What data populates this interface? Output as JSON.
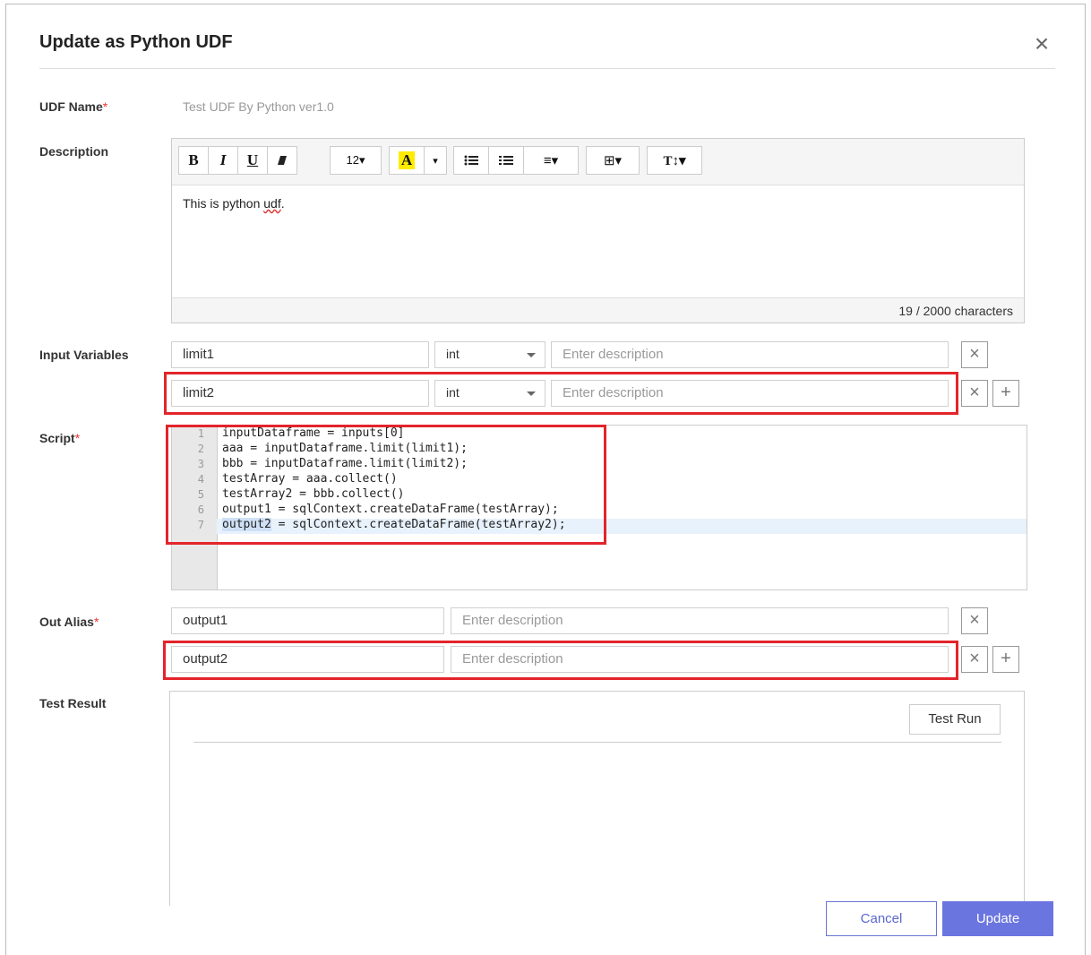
{
  "dialog": {
    "title": "Update as Python UDF",
    "close_glyph": "×"
  },
  "labels": {
    "udf_name": "UDF Name",
    "description": "Description",
    "input_variables": "Input Variables",
    "script": "Script",
    "out_alias": "Out Alias",
    "test_result": "Test Result",
    "required_mark": "*"
  },
  "udf_name": {
    "value": "Test UDF By Python ver1.0"
  },
  "description": {
    "toolbar": {
      "bold": "B",
      "italic": "I",
      "underline": "U",
      "eraser_icon": "eraser-icon",
      "font_size": "12▾",
      "font_color": "A",
      "font_color_caret": "▾",
      "bullet_list_icon": "bullet-list-icon",
      "numbered_list_icon": "numbered-list-icon",
      "align": "≡▾",
      "table": "⊞▾",
      "line_height": "T↕▾"
    },
    "text_before": "This is python ",
    "text_misspelled": "udf",
    "text_after": ".",
    "counter": "19 / 2000 characters"
  },
  "input_variables": [
    {
      "name": "limit1",
      "type": "int",
      "description_placeholder": "Enter description"
    },
    {
      "name": "limit2",
      "type": "int",
      "description_placeholder": "Enter description"
    }
  ],
  "script": {
    "line_numbers": [
      "1",
      "2",
      "3",
      "4",
      "5",
      "6",
      "7"
    ],
    "lines": [
      "inputDataframe = inputs[0]",
      "aaa = inputDataframe.limit(limit1);",
      "bbb = inputDataframe.limit(limit2);",
      "testArray = aaa.collect()",
      "testArray2 = bbb.collect()",
      "output1 = sqlContext.createDataFrame(testArray);"
    ],
    "last_line_selected": "output2",
    "last_line_rest": " = sqlContext.createDataFrame(testArray2);"
  },
  "out_alias": [
    {
      "name": "output1",
      "description_placeholder": "Enter description"
    },
    {
      "name": "output2",
      "description_placeholder": "Enter description"
    }
  ],
  "row_buttons": {
    "remove": "×",
    "add": "+"
  },
  "test_result": {
    "run_label": "Test Run"
  },
  "footer": {
    "cancel": "Cancel",
    "update": "Update"
  },
  "colors": {
    "primary": "#6b75e0",
    "highlight": "#e3242b",
    "required": "#e33333"
  }
}
